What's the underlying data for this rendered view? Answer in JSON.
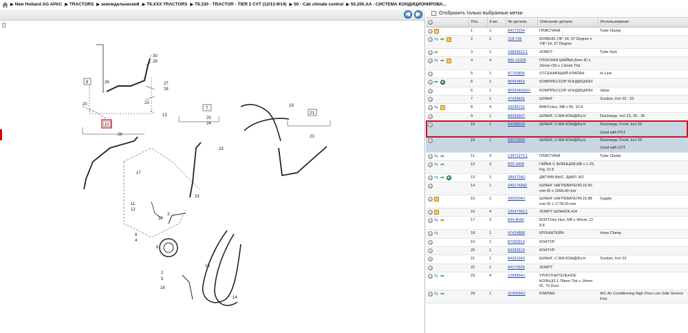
{
  "breadcrumb": [
    "New Holland AG APAC",
    "TRACTORS",
    "земледельческий",
    "T8.XXX TRACTORS",
    "T8.330 - TRACTOR - TIER 2 CVT (12/13-9/14)",
    "50 - Cab climate control",
    "50.200.AA - СИСТЕМА КОНДИЦИОНИРОВА..."
  ],
  "nav": {
    "back": "◀",
    "forward": "▶"
  },
  "filter_label": "Отобразить только выбранные метки",
  "columns": [
    "Поз.",
    "К-во",
    "№ детали",
    "Описание детали",
    "Использование"
  ],
  "colors": {
    "selection": "#d10e1c",
    "link": "#1a3fa8"
  },
  "diagram": {
    "callouts": [
      "30",
      "29",
      "26",
      "27",
      "28",
      "23",
      "13",
      "20",
      "19",
      "7",
      "25",
      "24",
      "23",
      "21",
      "10",
      "26",
      "17",
      "23",
      "23",
      "11",
      "12",
      "3",
      "18",
      "8",
      "4",
      "6",
      "15",
      "2",
      "5",
      "16",
      "14"
    ],
    "box_labels": [
      "9",
      "7",
      "21",
      "10"
    ]
  },
  "rows": [
    {
      "icons": [
        "grey",
        "box"
      ],
      "pos": "1",
      "qty": "1",
      "part": "84172254",
      "desc": "ПЛАСТИНА",
      "use": "Tube Clamp"
    },
    {
      "icons": [
        "grey",
        "sw",
        "ar",
        "box"
      ],
      "pos": "2",
      "qty": "1",
      "part": "218-736",
      "desc": "КОЛЕНО,7/8\"-14, 37 Degree x 7/8\"-14, 37 Degree",
      "use": ""
    },
    {
      "icons": [
        "grey",
        "ar"
      ],
      "pos": "3",
      "qty": "1",
      "part": "1989362C1",
      "desc": "ХОМУТ",
      "use": "Tube Hyd."
    },
    {
      "icons": [
        "grey",
        "sw",
        "ar",
        "box"
      ],
      "pos": "4",
      "qty": "4",
      "part": "895-11008",
      "desc": "ПЛОСКАЯ ШАЙБА,9mm ID x 16mm OD x 1.6mm Thk",
      "use": ""
    },
    {
      "icons": [
        "grey"
      ],
      "pos": "5",
      "qty": "1",
      "part": "87753805",
      "desc": "ОТСЕКАЮЩИЙ КЛАПАН",
      "use": "In-Line"
    },
    {
      "icons": [
        "grey",
        "ar",
        "gl"
      ],
      "pos": "6",
      "qty": "1",
      "part": "86993463",
      "desc": "КОМПРЕССОР КОНДИЦИОН",
      "use": ""
    },
    {
      "icons": [
        "grey"
      ],
      "pos": "6",
      "qty": "1",
      "part": "86993463GV",
      "desc": "КОМПРЕССОР КОНДИЦИОН",
      "use": "Value"
    },
    {
      "icons": [
        "grey"
      ],
      "pos": "7",
      "qty": "1",
      "part": "47426826",
      "desc": "ШЛАНГ",
      "use": "Suction, Incl 23 - 25"
    },
    {
      "icons": [
        "grey",
        "sw",
        "box"
      ],
      "pos": "8",
      "qty": "4",
      "part": "16045131",
      "desc": "ВИНТ,Hex, M8 x 95, 10.9",
      "use": ""
    },
    {
      "icons": [
        "grey"
      ],
      "pos": "9",
      "qty": "1",
      "part": "84292607",
      "desc": "ШЛАНГ, С-МА КОНДИЦ-Н",
      "use": "Discharge, Incl 23, 26 - 30"
    },
    {
      "icons": [
        "grey"
      ],
      "pos": "10",
      "qty": "1",
      "part": "84388609",
      "desc": "ШЛАНГ, С-МА КОНДИЦ-Н",
      "use": "Discharge, Front, Incl 26",
      "use2": "Used with PST",
      "sel": true
    },
    {
      "icons": [
        "grey"
      ],
      "pos": "10",
      "qty": "1",
      "part": "84579349",
      "desc": "ШЛАНГ, С-МА КОНДИЦ-Н",
      "use": "Discharge, Front, Incl 26",
      "use2": "Used with CVT",
      "sel2": true
    },
    {
      "icons": [
        "grey",
        "sw",
        "ar"
      ],
      "pos": "11",
      "qty": "3",
      "part": "1347127C1",
      "desc": "ПЛАСТИНА",
      "use": "Tube Clamp"
    },
    {
      "icons": [
        "grey",
        "sw",
        "ar"
      ],
      "pos": "12",
      "qty": "3",
      "part": "825-2408",
      "desc": "ГАЙКА С ФЛАНЦЕМ,M8 x 1.25, Flg, Cl 8",
      "use": ""
    },
    {
      "icons": [
        "grey",
        "sw",
        "ar",
        "gl"
      ],
      "pos": "13",
      "qty": "1",
      "part": "284273A2",
      "desc": "ДАТЧИК ВЫС. ДАВЛ. КО",
      "use": ""
    },
    {
      "icons": [
        "grey"
      ],
      "pos": "14",
      "qty": "1",
      "part": "340176682",
      "desc": "ШЛАНГ НАГРЕВАТЕЛЯ,15.50 mm ID x 1656.00 mm",
      "use": ""
    },
    {
      "icons": [
        "grey",
        "box"
      ],
      "pos": "15",
      "qty": "1",
      "part": "436520A1",
      "desc": "ШЛАНГ НАГРЕВАТЕЛЯ,15.88 mm ID x 1778.00 mm",
      "use": "Supply"
    },
    {
      "icons": [
        "grey",
        "box"
      ],
      "pos": "16",
      "qty": "4",
      "part": "1954736C1",
      "desc": "ХОМУТ ШЛАНГА,#24",
      "use": ""
    },
    {
      "icons": [
        "grey",
        "sw",
        "ar"
      ],
      "pos": "17",
      "qty": "2",
      "part": "844-8040",
      "desc": "БОЛТ,Hvy Hex, M8 x 40mm, Cl 8.8",
      "use": ""
    },
    {
      "icons": [
        "grey",
        "sw"
      ],
      "pos": "18",
      "qty": "1",
      "part": "47424888",
      "desc": "КРОНШТЕЙН",
      "use": "Hose Clamp"
    },
    {
      "icons": [
        "grey"
      ],
      "pos": "19",
      "qty": "1",
      "part": "87350913",
      "desc": "КОНТУР",
      "use": ""
    },
    {
      "icons": [
        "grey"
      ],
      "pos": "20",
      "qty": "1",
      "part": "84292619",
      "desc": "КОНТУР",
      "use": ""
    },
    {
      "icons": [
        "grey"
      ],
      "pos": "21",
      "qty": "1",
      "part": "84351343",
      "desc": "ШЛАНГ, С-МА КОНДИЦ-Н",
      "use": "Suction, Incl 23"
    },
    {
      "icons": [
        "grey"
      ],
      "pos": "22",
      "qty": "1",
      "part": "84172525",
      "desc": "ХОМУТ",
      "use": ""
    },
    {
      "icons": [
        "grey",
        "sw",
        "ar"
      ],
      "pos": "23",
      "qty": "4",
      "part": "128485A1",
      "desc": "УПЛОТНИТЕЛЬНОЕ КОЛЬЦО,1.78mm Thk x 14mm ID, 70 Duro",
      "use": ""
    },
    {
      "icons": [
        "grey",
        "sw",
        "ar"
      ],
      "pos": "24",
      "qty": "1",
      "part": "414093A1",
      "desc": "КЛАПАН",
      "use": "A/C Air Conditioning High Flow Low Side Service Port"
    }
  ]
}
